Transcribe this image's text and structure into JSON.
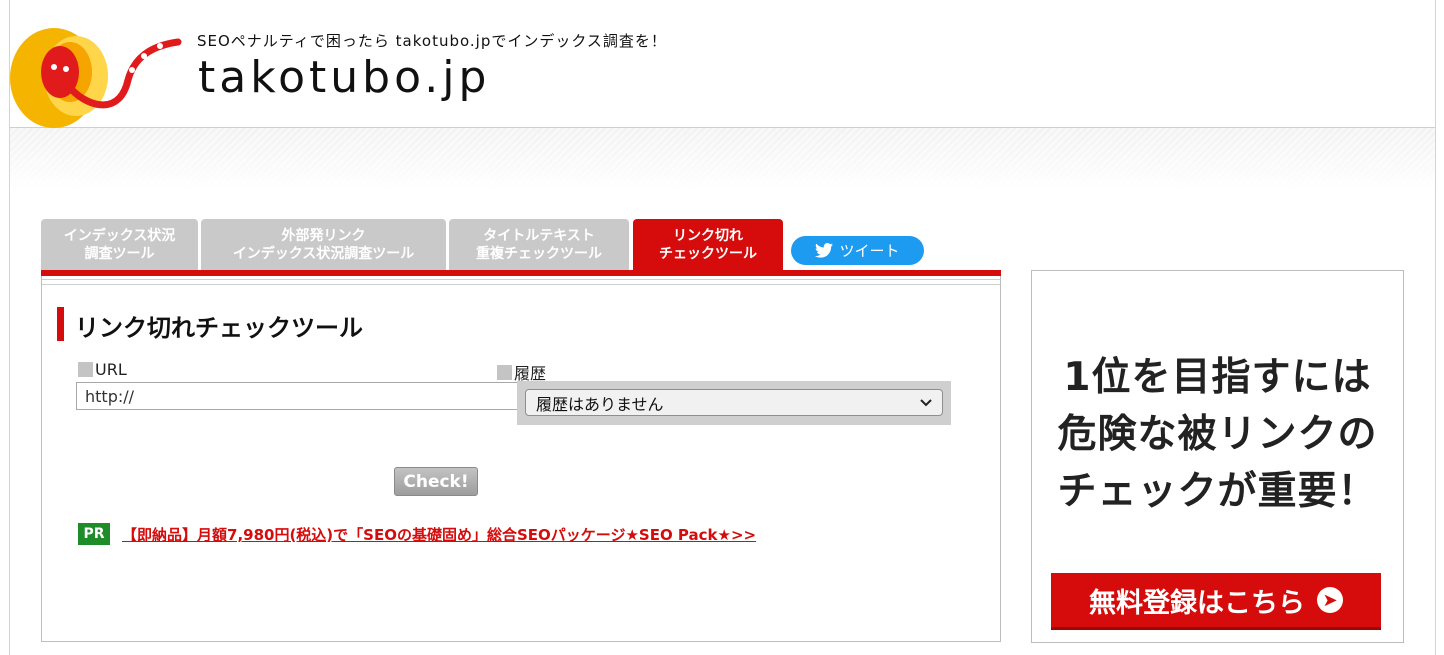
{
  "header": {
    "tagline": "SEOペナルティで困ったら takotubo.jpでインデックス調査を！",
    "site_name": "takotubo.jp"
  },
  "tabs": [
    {
      "line1": "インデックス状況",
      "line2": "調査ツール",
      "active": false
    },
    {
      "line1": "外部発リンク",
      "line2": "インデックス状況調査ツール",
      "active": false
    },
    {
      "line1": "タイトルテキスト",
      "line2": "重複チェックツール",
      "active": false
    },
    {
      "line1": "リンク切れ",
      "line2": "チェックツール",
      "active": true
    }
  ],
  "tweet": {
    "label": "ツイート",
    "icon": "twitter-bird-icon"
  },
  "panel": {
    "title": "リンク切れチェックツール",
    "url_label": "URL",
    "url_value": "http://",
    "history_label": "履歴",
    "history_selected": "履歴はありません",
    "check_button": "Check!",
    "pr_badge": "PR",
    "pr_link": "【即納品】月額7,980円(税込)で「SEOの基礎固め」総合SEOパッケージ★SEO Pack★>>"
  },
  "ad": {
    "line1": "1位を目指すには",
    "line2": "危険な被リンクの",
    "line3": "チェックが重要！",
    "button": "無料登録はこちら"
  },
  "colors": {
    "accent_red": "#d60b0b",
    "tab_grey": "#c9c9c9",
    "twitter_blue": "#1d9bf0",
    "pr_green": "#1e8c28"
  }
}
